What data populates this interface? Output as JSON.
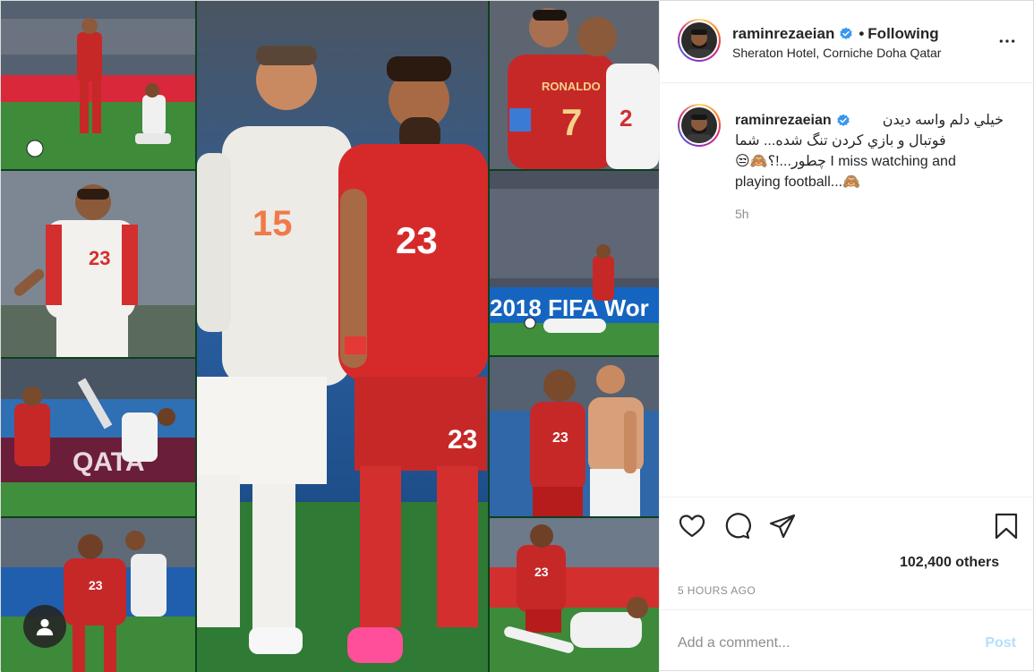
{
  "post": {
    "author": {
      "username": "raminrezaeian",
      "verified": true,
      "follow_state": "Following",
      "separator": "•",
      "location": "Sheraton Hotel, Corniche Doha Qatar"
    },
    "caption": {
      "username": "raminrezaeian",
      "line1": "خيلي دلم واسه ديدن",
      "line2": "فوتبال و بازي كردن تنگ شده... شما",
      "line3": "😒🙈چطور...!؟ I miss watching and",
      "line4": "playing football...🙈",
      "time_ago": "5h"
    },
    "likes_text": "102,400 others",
    "posted_time": "5 HOURS AGO",
    "comment": {
      "placeholder": "Add a comment...",
      "post_label": "Post"
    },
    "media": {
      "photo_texts": {
        "ronaldo_name": "RONALDO",
        "ronaldo_number": "7",
        "spain_number": "15",
        "iran_number": "23",
        "banner_left": "2018 FIFA Wor"
      }
    }
  },
  "icons": {
    "like": "heart-icon",
    "comment": "comment-icon",
    "share": "paper-plane-icon",
    "save": "bookmark-icon",
    "more": "more-options-icon",
    "tag": "user-tag-icon",
    "verified": "verified-badge-icon"
  },
  "colors": {
    "verified_blue": "#3897f0",
    "post_button_disabled": "#b2dffc",
    "iran_red": "#d62a2a",
    "spain_white": "#ecebe6",
    "pitch_green": "#2e7d32"
  }
}
